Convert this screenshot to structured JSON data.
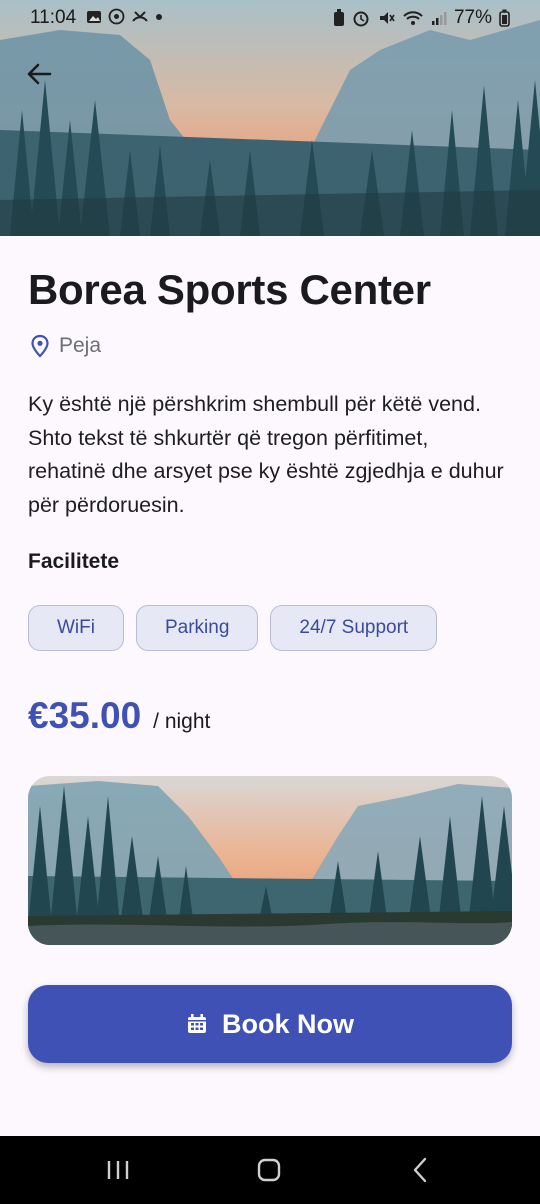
{
  "status_bar": {
    "time": "11:04",
    "left_icons": [
      "gallery-icon",
      "whatsapp-icon",
      "missed-call-icon",
      "dot-icon"
    ],
    "right_icons": [
      "battery-saver-icon",
      "alarm-icon",
      "mute-icon",
      "wifi-icon",
      "signal-icon",
      "battery-icon"
    ],
    "battery": "77%"
  },
  "venue": {
    "title": "Borea Sports Center",
    "location": "Peja",
    "description": "Ky është një përshkrim shembull për këtë vend. Shto tekst të shkurtër që tregon përfitimet, rehatinë dhe arsyet pse ky është zgjedhja e duhur për përdoruesin."
  },
  "facilities": {
    "title": "Facilitete",
    "items": [
      "WiFi",
      "Parking",
      "24/7 Support"
    ]
  },
  "pricing": {
    "amount": "€35.00",
    "unit": "/ night"
  },
  "book_button": {
    "label": "Book Now",
    "icon": "calendar-icon"
  },
  "colors": {
    "primary": "#3f51b5",
    "chip_bg": "#e6e9f5",
    "chip_text": "#3b4a9b",
    "background": "#fcf8fe"
  }
}
